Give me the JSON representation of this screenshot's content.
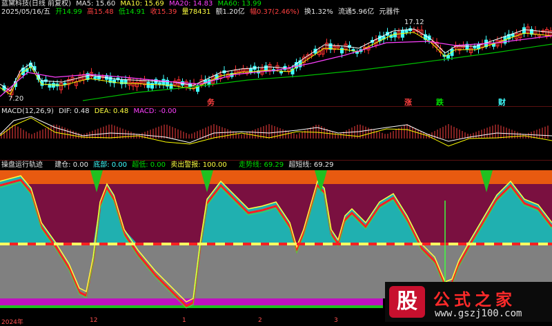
{
  "price_header": {
    "title": "蓝黛科技(日线 前复权)",
    "ma5": "MA5: 15.60",
    "ma10": "MA10: 15.69",
    "ma20": "MA20: 14.83",
    "ma60": "MA60: 13.99"
  },
  "quote_line": {
    "date": "2025/05/16/五",
    "open": "开14.99",
    "high": "高15.48",
    "low": "低14.91",
    "close": "收15.39",
    "volume": "量78431",
    "amount": "额1.20亿",
    "change": "幅0.37(2.46%)",
    "turnover": "换1.32%",
    "float": "流通5.96亿",
    "sector": "元器件"
  },
  "price_annotations": {
    "high_mark": "17.12",
    "low_mark": "7.20"
  },
  "event_labels": [
    "务",
    "涨",
    "跌",
    "财"
  ],
  "macd_header": {
    "title": "MACD(12,26,9)",
    "dif": "DIF: 0.48",
    "dea": "DEA: 0.48",
    "macd": "MACD: -0.00"
  },
  "osc_header": {
    "title": "操盘运行轨迹",
    "jiancang": "建仓: 0.00",
    "dibu": "底部: 0.00",
    "chaodi": "超低: 0.00",
    "maichu": "卖出警报: 100.00",
    "zoushi": "走势线: 69.29",
    "chaomai": "超短线: 69.29"
  },
  "x_axis": [
    "2024年",
    "12",
    "1",
    "2",
    "3"
  ],
  "watermark": {
    "logo": "股",
    "title": "公式之家",
    "url": "www.gszj100.com"
  },
  "colors": {
    "up": "#ff3030",
    "down": "#40ffff",
    "ma5": "#ffffff",
    "ma10": "#ffff00",
    "ma20": "#ff40ff",
    "ma60": "#00c000",
    "osc_top": "#e85a10",
    "osc_upper": "#7a1040",
    "osc_lower": "#808080",
    "osc_fill": "#20b0b0",
    "osc_spike": "#20c020"
  }
}
